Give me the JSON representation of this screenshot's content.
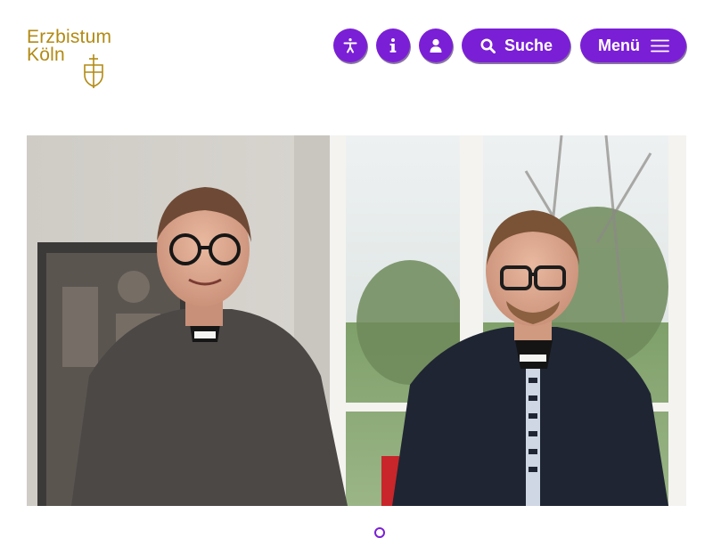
{
  "brand": {
    "line1": "Erzbistum",
    "line2": "Köln",
    "logo_color": "#b28a14"
  },
  "header": {
    "accent_color": "#7a1fd6",
    "icons": [
      "accessibility-icon",
      "info-icon",
      "user-icon"
    ],
    "search_label": "Suche",
    "menu_label": "Menü"
  },
  "hero_image": {
    "subject": "photo"
  }
}
